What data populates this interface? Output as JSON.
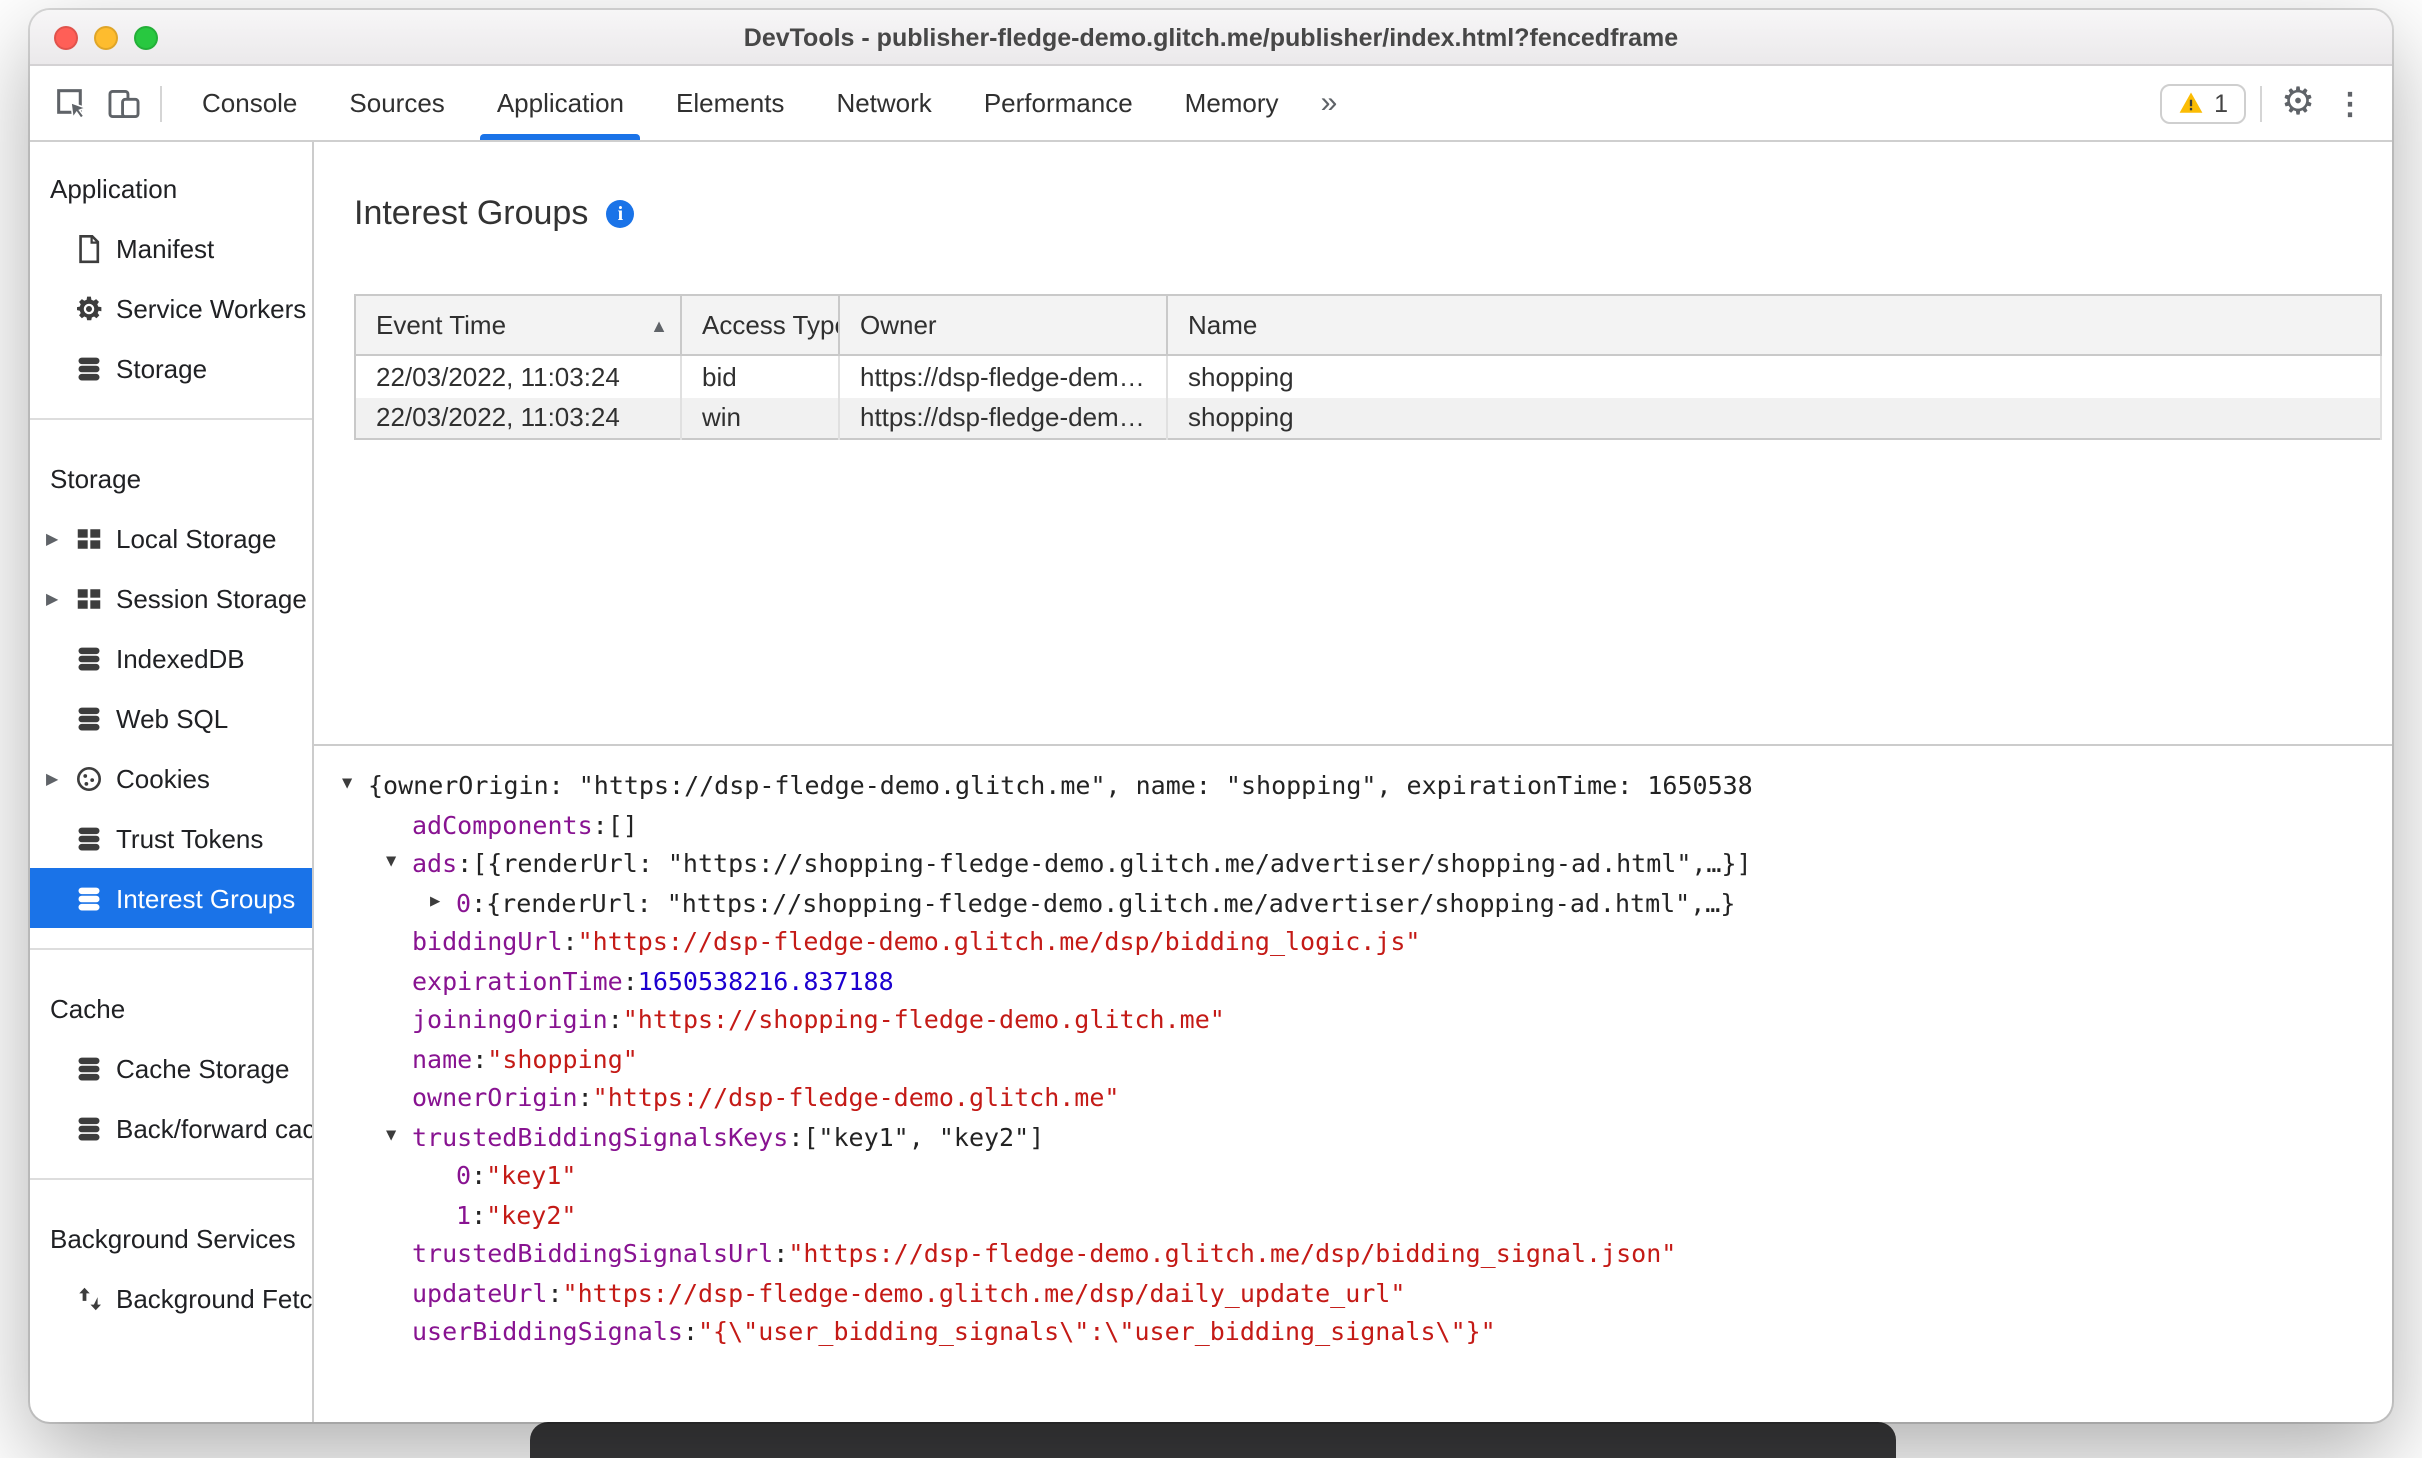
{
  "window": {
    "title": "DevTools - publisher-fledge-demo.glitch.me/publisher/index.html?fencedframe"
  },
  "colors": {
    "accent": "#1a73e8",
    "selected_row_bg": "#1a73e8",
    "tree_key": "#881391",
    "tree_string": "#c41a16",
    "tree_number": "#1c00cf",
    "warning_fill": "#fbbc04",
    "traffic_red": "#ff5f57",
    "traffic_yellow": "#febc2e",
    "traffic_green": "#28c840"
  },
  "icons": {
    "more_tabs": "»",
    "gear": "⚙",
    "kebab": "⋮",
    "sort_asc": "▲",
    "collapsed": "▶",
    "expanded": "▼",
    "info_glyph": "i"
  },
  "toolbar": {
    "tabs": [
      {
        "label": "Console"
      },
      {
        "label": "Sources"
      },
      {
        "label": "Application"
      },
      {
        "label": "Elements"
      },
      {
        "label": "Network"
      },
      {
        "label": "Performance"
      },
      {
        "label": "Memory"
      }
    ],
    "active_tab": "Application",
    "warning_count": "1"
  },
  "sidebar": {
    "sections": [
      {
        "header": "Application",
        "items": [
          {
            "label": "Manifest",
            "icon": "document-icon"
          },
          {
            "label": "Service Workers",
            "icon": "gear-icon"
          },
          {
            "label": "Storage",
            "icon": "database-icon"
          }
        ]
      },
      {
        "header": "Storage",
        "items": [
          {
            "label": "Local Storage",
            "icon": "table-icon",
            "expandable": true
          },
          {
            "label": "Session Storage",
            "icon": "table-icon",
            "expandable": true
          },
          {
            "label": "IndexedDB",
            "icon": "database-icon"
          },
          {
            "label": "Web SQL",
            "icon": "database-icon"
          },
          {
            "label": "Cookies",
            "icon": "cookie-icon",
            "expandable": true
          },
          {
            "label": "Trust Tokens",
            "icon": "database-icon"
          },
          {
            "label": "Interest Groups",
            "icon": "database-icon",
            "selected": true
          }
        ]
      },
      {
        "header": "Cache",
        "items": [
          {
            "label": "Cache Storage",
            "icon": "database-icon"
          },
          {
            "label": "Back/forward cache",
            "icon": "database-icon"
          }
        ]
      },
      {
        "header": "Background Services",
        "items": [
          {
            "label": "Background Fetch",
            "icon": "fetch-arrows-icon"
          }
        ]
      }
    ]
  },
  "main": {
    "title": "Interest Groups",
    "table": {
      "columns": [
        "Event Time",
        "Access Type",
        "Owner",
        "Name"
      ],
      "sorted_column": "Event Time",
      "rows": [
        [
          "22/03/2022, 11:03:24",
          "bid",
          "https://dsp-fledge-demo.gl…",
          "shopping"
        ],
        [
          "22/03/2022, 11:03:24",
          "win",
          "https://dsp-fledge-demo.gl…",
          "shopping"
        ]
      ]
    },
    "tree": {
      "lines": [
        {
          "indent": 0,
          "arrow": "down",
          "segments": [
            {
              "t": "{ownerOrigin: \"https://dsp-fledge-demo.glitch.me\", name: \"shopping\", expirationTime: 1650538",
              "c": "plain"
            }
          ]
        },
        {
          "indent": 1,
          "arrow": null,
          "segments": [
            {
              "t": "adComponents",
              "c": "key"
            },
            {
              "t": ": ",
              "c": "plain"
            },
            {
              "t": "[]",
              "c": "plain"
            }
          ]
        },
        {
          "indent": 1,
          "arrow": "down",
          "segments": [
            {
              "t": "ads",
              "c": "key"
            },
            {
              "t": ": ",
              "c": "plain"
            },
            {
              "t": "[{renderUrl: \"https://shopping-fledge-demo.glitch.me/advertiser/shopping-ad.html\",…}]",
              "c": "plain"
            }
          ]
        },
        {
          "indent": 2,
          "arrow": "right",
          "segments": [
            {
              "t": "0",
              "c": "key"
            },
            {
              "t": ": ",
              "c": "plain"
            },
            {
              "t": "{renderUrl: \"https://shopping-fledge-demo.glitch.me/advertiser/shopping-ad.html\",…}",
              "c": "plain"
            }
          ]
        },
        {
          "indent": 1,
          "arrow": null,
          "segments": [
            {
              "t": "biddingUrl",
              "c": "key"
            },
            {
              "t": ": ",
              "c": "plain"
            },
            {
              "t": "\"https://dsp-fledge-demo.glitch.me/dsp/bidding_logic.js\"",
              "c": "string"
            }
          ]
        },
        {
          "indent": 1,
          "arrow": null,
          "segments": [
            {
              "t": "expirationTime",
              "c": "key"
            },
            {
              "t": ": ",
              "c": "plain"
            },
            {
              "t": "1650538216.837188",
              "c": "number"
            }
          ]
        },
        {
          "indent": 1,
          "arrow": null,
          "segments": [
            {
              "t": "joiningOrigin",
              "c": "key"
            },
            {
              "t": ": ",
              "c": "plain"
            },
            {
              "t": "\"https://shopping-fledge-demo.glitch.me\"",
              "c": "string"
            }
          ]
        },
        {
          "indent": 1,
          "arrow": null,
          "segments": [
            {
              "t": "name",
              "c": "key"
            },
            {
              "t": ": ",
              "c": "plain"
            },
            {
              "t": "\"shopping\"",
              "c": "string"
            }
          ]
        },
        {
          "indent": 1,
          "arrow": null,
          "segments": [
            {
              "t": "ownerOrigin",
              "c": "key"
            },
            {
              "t": ": ",
              "c": "plain"
            },
            {
              "t": "\"https://dsp-fledge-demo.glitch.me\"",
              "c": "string"
            }
          ]
        },
        {
          "indent": 1,
          "arrow": "down",
          "segments": [
            {
              "t": "trustedBiddingSignalsKeys",
              "c": "key"
            },
            {
              "t": ": ",
              "c": "plain"
            },
            {
              "t": "[\"key1\", \"key2\"]",
              "c": "plain"
            }
          ]
        },
        {
          "indent": 2,
          "arrow": null,
          "segments": [
            {
              "t": "0",
              "c": "key"
            },
            {
              "t": ": ",
              "c": "plain"
            },
            {
              "t": "\"key1\"",
              "c": "string"
            }
          ]
        },
        {
          "indent": 2,
          "arrow": null,
          "segments": [
            {
              "t": "1",
              "c": "key"
            },
            {
              "t": ": ",
              "c": "plain"
            },
            {
              "t": "\"key2\"",
              "c": "string"
            }
          ]
        },
        {
          "indent": 1,
          "arrow": null,
          "segments": [
            {
              "t": "trustedBiddingSignalsUrl",
              "c": "key"
            },
            {
              "t": ": ",
              "c": "plain"
            },
            {
              "t": "\"https://dsp-fledge-demo.glitch.me/dsp/bidding_signal.json\"",
              "c": "string"
            }
          ]
        },
        {
          "indent": 1,
          "arrow": null,
          "segments": [
            {
              "t": "updateUrl",
              "c": "key"
            },
            {
              "t": ": ",
              "c": "plain"
            },
            {
              "t": "\"https://dsp-fledge-demo.glitch.me/dsp/daily_update_url\"",
              "c": "string"
            }
          ]
        },
        {
          "indent": 1,
          "arrow": null,
          "segments": [
            {
              "t": "userBiddingSignals",
              "c": "key"
            },
            {
              "t": ": ",
              "c": "plain"
            },
            {
              "t": "\"{\\\"user_bidding_signals\\\":\\\"user_bidding_signals\\\"}\"",
              "c": "string"
            }
          ]
        }
      ]
    }
  }
}
